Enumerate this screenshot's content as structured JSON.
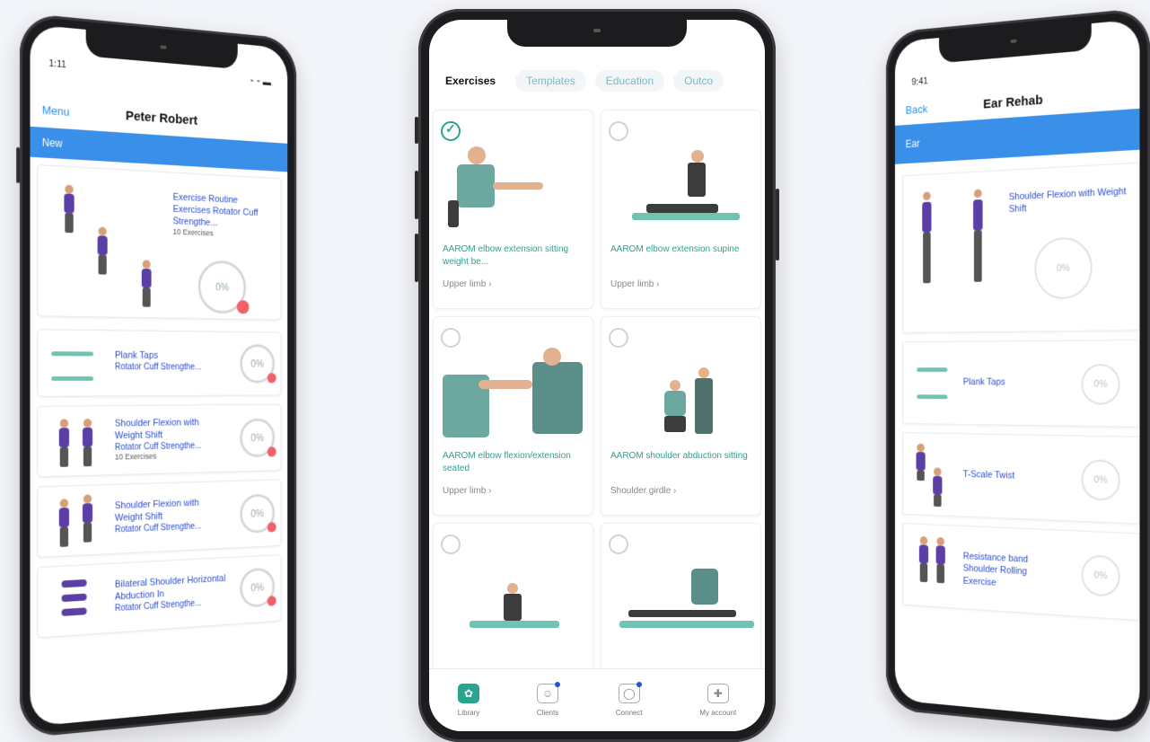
{
  "phone_left": {
    "status_time": "1:11",
    "status_icons": "⁃ ⁃ ▬",
    "nav_back": "Menu",
    "nav_title": "Peter Robert",
    "blue_bar": "New",
    "hero": {
      "title": "Exercise Routine Exercises Rotator Cuff Strengthe...",
      "count": "10 Exercises",
      "progress": "0%"
    },
    "items": [
      {
        "title": "Plank Taps",
        "sub": "Rotator Cuff Strengthe...",
        "progress": "0%"
      },
      {
        "title": "Shoulder Flexion with Weight Shift",
        "sub": "Rotator Cuff Strengthe...",
        "count": "10 Exercises",
        "progress": "0%"
      },
      {
        "title": "Shoulder Flexion with Weight Shift",
        "sub": "Rotator Cuff Strengthe...",
        "progress": "0%"
      },
      {
        "title": "Bilateral Shoulder Horizontal Abduction In",
        "sub": "Rotator Cuff Strengthe...",
        "progress": "0%"
      }
    ]
  },
  "phone_center": {
    "tabs": [
      "Exercises",
      "Templates",
      "Education",
      "Outco"
    ],
    "exercises": [
      {
        "title": "AAROM elbow extension sitting weight be...",
        "category": "Upper limb  ›",
        "checked": true
      },
      {
        "title": "AAROM elbow extension supine",
        "category": "Upper limb  ›",
        "checked": false
      },
      {
        "title": "AAROM elbow flexion/extension seated",
        "category": "Upper limb  ›",
        "checked": false
      },
      {
        "title": "AAROM shoulder abduction sitting",
        "category": "Shoulder girdle  ›",
        "checked": false
      },
      {
        "title": "",
        "category": "",
        "checked": false
      },
      {
        "title": "",
        "category": "",
        "checked": false
      }
    ],
    "bottom_nav": [
      "Library",
      "Clients",
      "Connect",
      "My account"
    ]
  },
  "phone_right": {
    "status_time": "9:41",
    "nav_back": "Back",
    "nav_title": "Ear Rehab",
    "blue_bar": "Ear",
    "hero": {
      "title": "Shoulder Flexion with Weight Shift",
      "progress": "0%"
    },
    "items": [
      {
        "title": "Plank Taps",
        "progress": "0%"
      },
      {
        "title": "T-Scale Twist",
        "progress": "0%"
      },
      {
        "title": "Resistance band Shoulder Rolling Exercise",
        "progress": "0%"
      }
    ]
  },
  "colors": {
    "brand_blue": "#3a90e8",
    "teal": "#2aa38f",
    "link_blue": "#2b4fd1",
    "progress_dot": "#f2616a"
  }
}
